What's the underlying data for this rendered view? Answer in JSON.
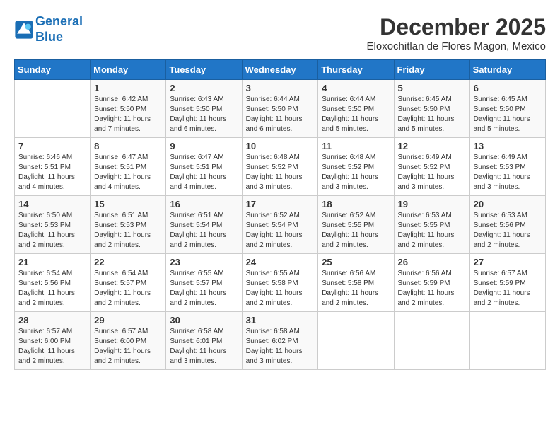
{
  "logo": {
    "line1": "General",
    "line2": "Blue"
  },
  "title": "December 2025",
  "location": "Eloxochitlan de Flores Magon, Mexico",
  "days_of_week": [
    "Sunday",
    "Monday",
    "Tuesday",
    "Wednesday",
    "Thursday",
    "Friday",
    "Saturday"
  ],
  "weeks": [
    [
      {
        "day": "",
        "info": ""
      },
      {
        "day": "1",
        "info": "Sunrise: 6:42 AM\nSunset: 5:50 PM\nDaylight: 11 hours\nand 7 minutes."
      },
      {
        "day": "2",
        "info": "Sunrise: 6:43 AM\nSunset: 5:50 PM\nDaylight: 11 hours\nand 6 minutes."
      },
      {
        "day": "3",
        "info": "Sunrise: 6:44 AM\nSunset: 5:50 PM\nDaylight: 11 hours\nand 6 minutes."
      },
      {
        "day": "4",
        "info": "Sunrise: 6:44 AM\nSunset: 5:50 PM\nDaylight: 11 hours\nand 5 minutes."
      },
      {
        "day": "5",
        "info": "Sunrise: 6:45 AM\nSunset: 5:50 PM\nDaylight: 11 hours\nand 5 minutes."
      },
      {
        "day": "6",
        "info": "Sunrise: 6:45 AM\nSunset: 5:50 PM\nDaylight: 11 hours\nand 5 minutes."
      }
    ],
    [
      {
        "day": "7",
        "info": "Sunrise: 6:46 AM\nSunset: 5:51 PM\nDaylight: 11 hours\nand 4 minutes."
      },
      {
        "day": "8",
        "info": "Sunrise: 6:47 AM\nSunset: 5:51 PM\nDaylight: 11 hours\nand 4 minutes."
      },
      {
        "day": "9",
        "info": "Sunrise: 6:47 AM\nSunset: 5:51 PM\nDaylight: 11 hours\nand 4 minutes."
      },
      {
        "day": "10",
        "info": "Sunrise: 6:48 AM\nSunset: 5:52 PM\nDaylight: 11 hours\nand 3 minutes."
      },
      {
        "day": "11",
        "info": "Sunrise: 6:48 AM\nSunset: 5:52 PM\nDaylight: 11 hours\nand 3 minutes."
      },
      {
        "day": "12",
        "info": "Sunrise: 6:49 AM\nSunset: 5:52 PM\nDaylight: 11 hours\nand 3 minutes."
      },
      {
        "day": "13",
        "info": "Sunrise: 6:49 AM\nSunset: 5:53 PM\nDaylight: 11 hours\nand 3 minutes."
      }
    ],
    [
      {
        "day": "14",
        "info": "Sunrise: 6:50 AM\nSunset: 5:53 PM\nDaylight: 11 hours\nand 2 minutes."
      },
      {
        "day": "15",
        "info": "Sunrise: 6:51 AM\nSunset: 5:53 PM\nDaylight: 11 hours\nand 2 minutes."
      },
      {
        "day": "16",
        "info": "Sunrise: 6:51 AM\nSunset: 5:54 PM\nDaylight: 11 hours\nand 2 minutes."
      },
      {
        "day": "17",
        "info": "Sunrise: 6:52 AM\nSunset: 5:54 PM\nDaylight: 11 hours\nand 2 minutes."
      },
      {
        "day": "18",
        "info": "Sunrise: 6:52 AM\nSunset: 5:55 PM\nDaylight: 11 hours\nand 2 minutes."
      },
      {
        "day": "19",
        "info": "Sunrise: 6:53 AM\nSunset: 5:55 PM\nDaylight: 11 hours\nand 2 minutes."
      },
      {
        "day": "20",
        "info": "Sunrise: 6:53 AM\nSunset: 5:56 PM\nDaylight: 11 hours\nand 2 minutes."
      }
    ],
    [
      {
        "day": "21",
        "info": "Sunrise: 6:54 AM\nSunset: 5:56 PM\nDaylight: 11 hours\nand 2 minutes."
      },
      {
        "day": "22",
        "info": "Sunrise: 6:54 AM\nSunset: 5:57 PM\nDaylight: 11 hours\nand 2 minutes."
      },
      {
        "day": "23",
        "info": "Sunrise: 6:55 AM\nSunset: 5:57 PM\nDaylight: 11 hours\nand 2 minutes."
      },
      {
        "day": "24",
        "info": "Sunrise: 6:55 AM\nSunset: 5:58 PM\nDaylight: 11 hours\nand 2 minutes."
      },
      {
        "day": "25",
        "info": "Sunrise: 6:56 AM\nSunset: 5:58 PM\nDaylight: 11 hours\nand 2 minutes."
      },
      {
        "day": "26",
        "info": "Sunrise: 6:56 AM\nSunset: 5:59 PM\nDaylight: 11 hours\nand 2 minutes."
      },
      {
        "day": "27",
        "info": "Sunrise: 6:57 AM\nSunset: 5:59 PM\nDaylight: 11 hours\nand 2 minutes."
      }
    ],
    [
      {
        "day": "28",
        "info": "Sunrise: 6:57 AM\nSunset: 6:00 PM\nDaylight: 11 hours\nand 2 minutes."
      },
      {
        "day": "29",
        "info": "Sunrise: 6:57 AM\nSunset: 6:00 PM\nDaylight: 11 hours\nand 2 minutes."
      },
      {
        "day": "30",
        "info": "Sunrise: 6:58 AM\nSunset: 6:01 PM\nDaylight: 11 hours\nand 3 minutes."
      },
      {
        "day": "31",
        "info": "Sunrise: 6:58 AM\nSunset: 6:02 PM\nDaylight: 11 hours\nand 3 minutes."
      },
      {
        "day": "",
        "info": ""
      },
      {
        "day": "",
        "info": ""
      },
      {
        "day": "",
        "info": ""
      }
    ]
  ]
}
